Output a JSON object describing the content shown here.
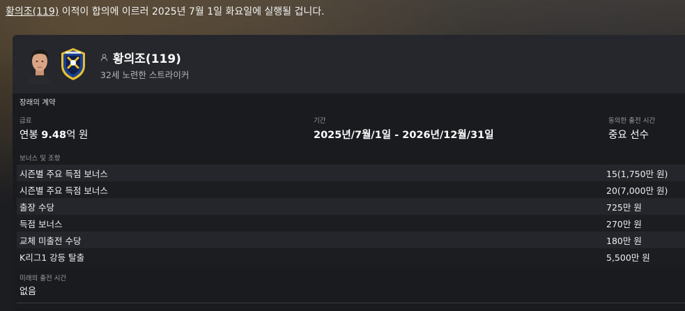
{
  "headline": {
    "player_link": "황의조(119)",
    "text": " 이적이 합의에 이르러 2025년 7월 1일 화요일에 실행될 겁니다."
  },
  "player": {
    "name": "황의조(119)",
    "description": "32세 노련한 스트라이커",
    "icons": [
      "player-face",
      "club-crest",
      "person-icon"
    ]
  },
  "contract": {
    "section_title": "장래의 계약",
    "salary_label": "급료",
    "salary_prefix": "연봉 ",
    "salary_number": "9.48",
    "salary_suffix": "억 원",
    "period_label": "기간",
    "period_value": "2025년/7월/1일 - 2026년/12월/31일",
    "playing_time_label": "동의한 출전 시간",
    "playing_time_value": "중요 선수",
    "bonus_label": "보너스 및 조항",
    "bonuses": [
      {
        "name": "시즌별 주요 득점 보너스",
        "amount": "15(1,750만 원)"
      },
      {
        "name": "시즌별 주요 득점 보너스",
        "amount": "20(7,000만 원)"
      },
      {
        "name": "출장 수당",
        "amount": "725만 원"
      },
      {
        "name": "득점 보너스",
        "amount": "270만 원"
      },
      {
        "name": "교체 미출전 수당",
        "amount": "180만 원"
      },
      {
        "name": "K리그1 강등 탈출",
        "amount": "5,500만 원"
      }
    ],
    "future_label": "미래의 출전 시간",
    "future_value": "없음"
  },
  "colors": {
    "panel_bg": "#1a1b1f",
    "card_bg": "#26272c",
    "row_odd": "#25262b",
    "crest_blue": "#1b3f8f",
    "crest_yellow": "#e7c12f"
  }
}
